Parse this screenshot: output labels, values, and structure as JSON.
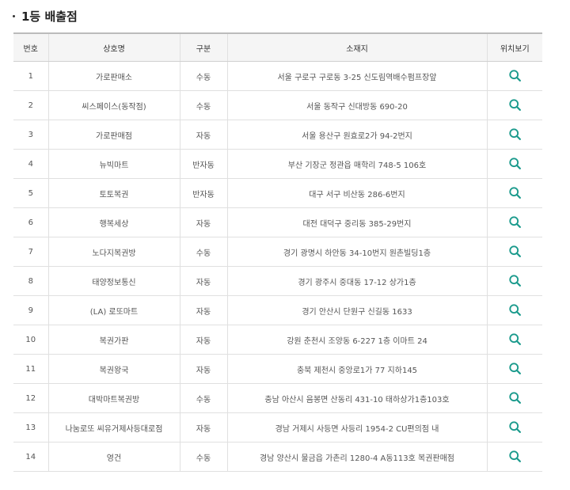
{
  "title": "1등 배출점",
  "colors": {
    "accent": "#1a9a8c",
    "header_bg": "#f5f5f5"
  },
  "columns": [
    "번호",
    "상호명",
    "구분",
    "소재지",
    "위치보기"
  ],
  "rows": [
    {
      "no": "1",
      "name": "가로판매소",
      "type": "수동",
      "address": "서울 구로구 구로동 3-25 신도림역배수펌프장앞"
    },
    {
      "no": "2",
      "name": "씨스페이스(동작점)",
      "type": "수동",
      "address": "서울 동작구 신대방동 690-20"
    },
    {
      "no": "3",
      "name": "가로판매점",
      "type": "자동",
      "address": "서울 용산구 원효로2가 94-2번지"
    },
    {
      "no": "4",
      "name": "뉴빅마트",
      "type": "반자동",
      "address": "부산 기장군 정관읍 매학리 748-5 106호"
    },
    {
      "no": "5",
      "name": "토토복권",
      "type": "반자동",
      "address": "대구 서구 비산동 286-6번지"
    },
    {
      "no": "6",
      "name": "행복세상",
      "type": "자동",
      "address": "대전 대덕구 중리동 385-29번지"
    },
    {
      "no": "7",
      "name": "노다지복권방",
      "type": "수동",
      "address": "경기 광명시 하안동 34-10번지 원촌빌딩1층"
    },
    {
      "no": "8",
      "name": "태양정보통신",
      "type": "자동",
      "address": "경기 광주시 중대동 17-12 상가1층"
    },
    {
      "no": "9",
      "name": "(LA) 로또마트",
      "type": "자동",
      "address": "경기 안산시 단원구 신길동 1633"
    },
    {
      "no": "10",
      "name": "복권가판",
      "type": "자동",
      "address": "강원 춘천시 조양동 6-227 1층 이마트 24"
    },
    {
      "no": "11",
      "name": "복권왕국",
      "type": "자동",
      "address": "충북 제천시 중앙로1가 77 지하145"
    },
    {
      "no": "12",
      "name": "대박마트복권방",
      "type": "수동",
      "address": "충남 아산시 음봉면 산동리 431-10 태하상가1층103호"
    },
    {
      "no": "13",
      "name": "나눔로또 씨유거제사등대로점",
      "type": "자동",
      "address": "경남 거제시 사등면 사등리 1954-2 CU편의점 내"
    },
    {
      "no": "14",
      "name": "영건",
      "type": "수동",
      "address": "경남 양산시 물금읍 가촌리 1280-4 A동113호 복권판매점"
    }
  ]
}
